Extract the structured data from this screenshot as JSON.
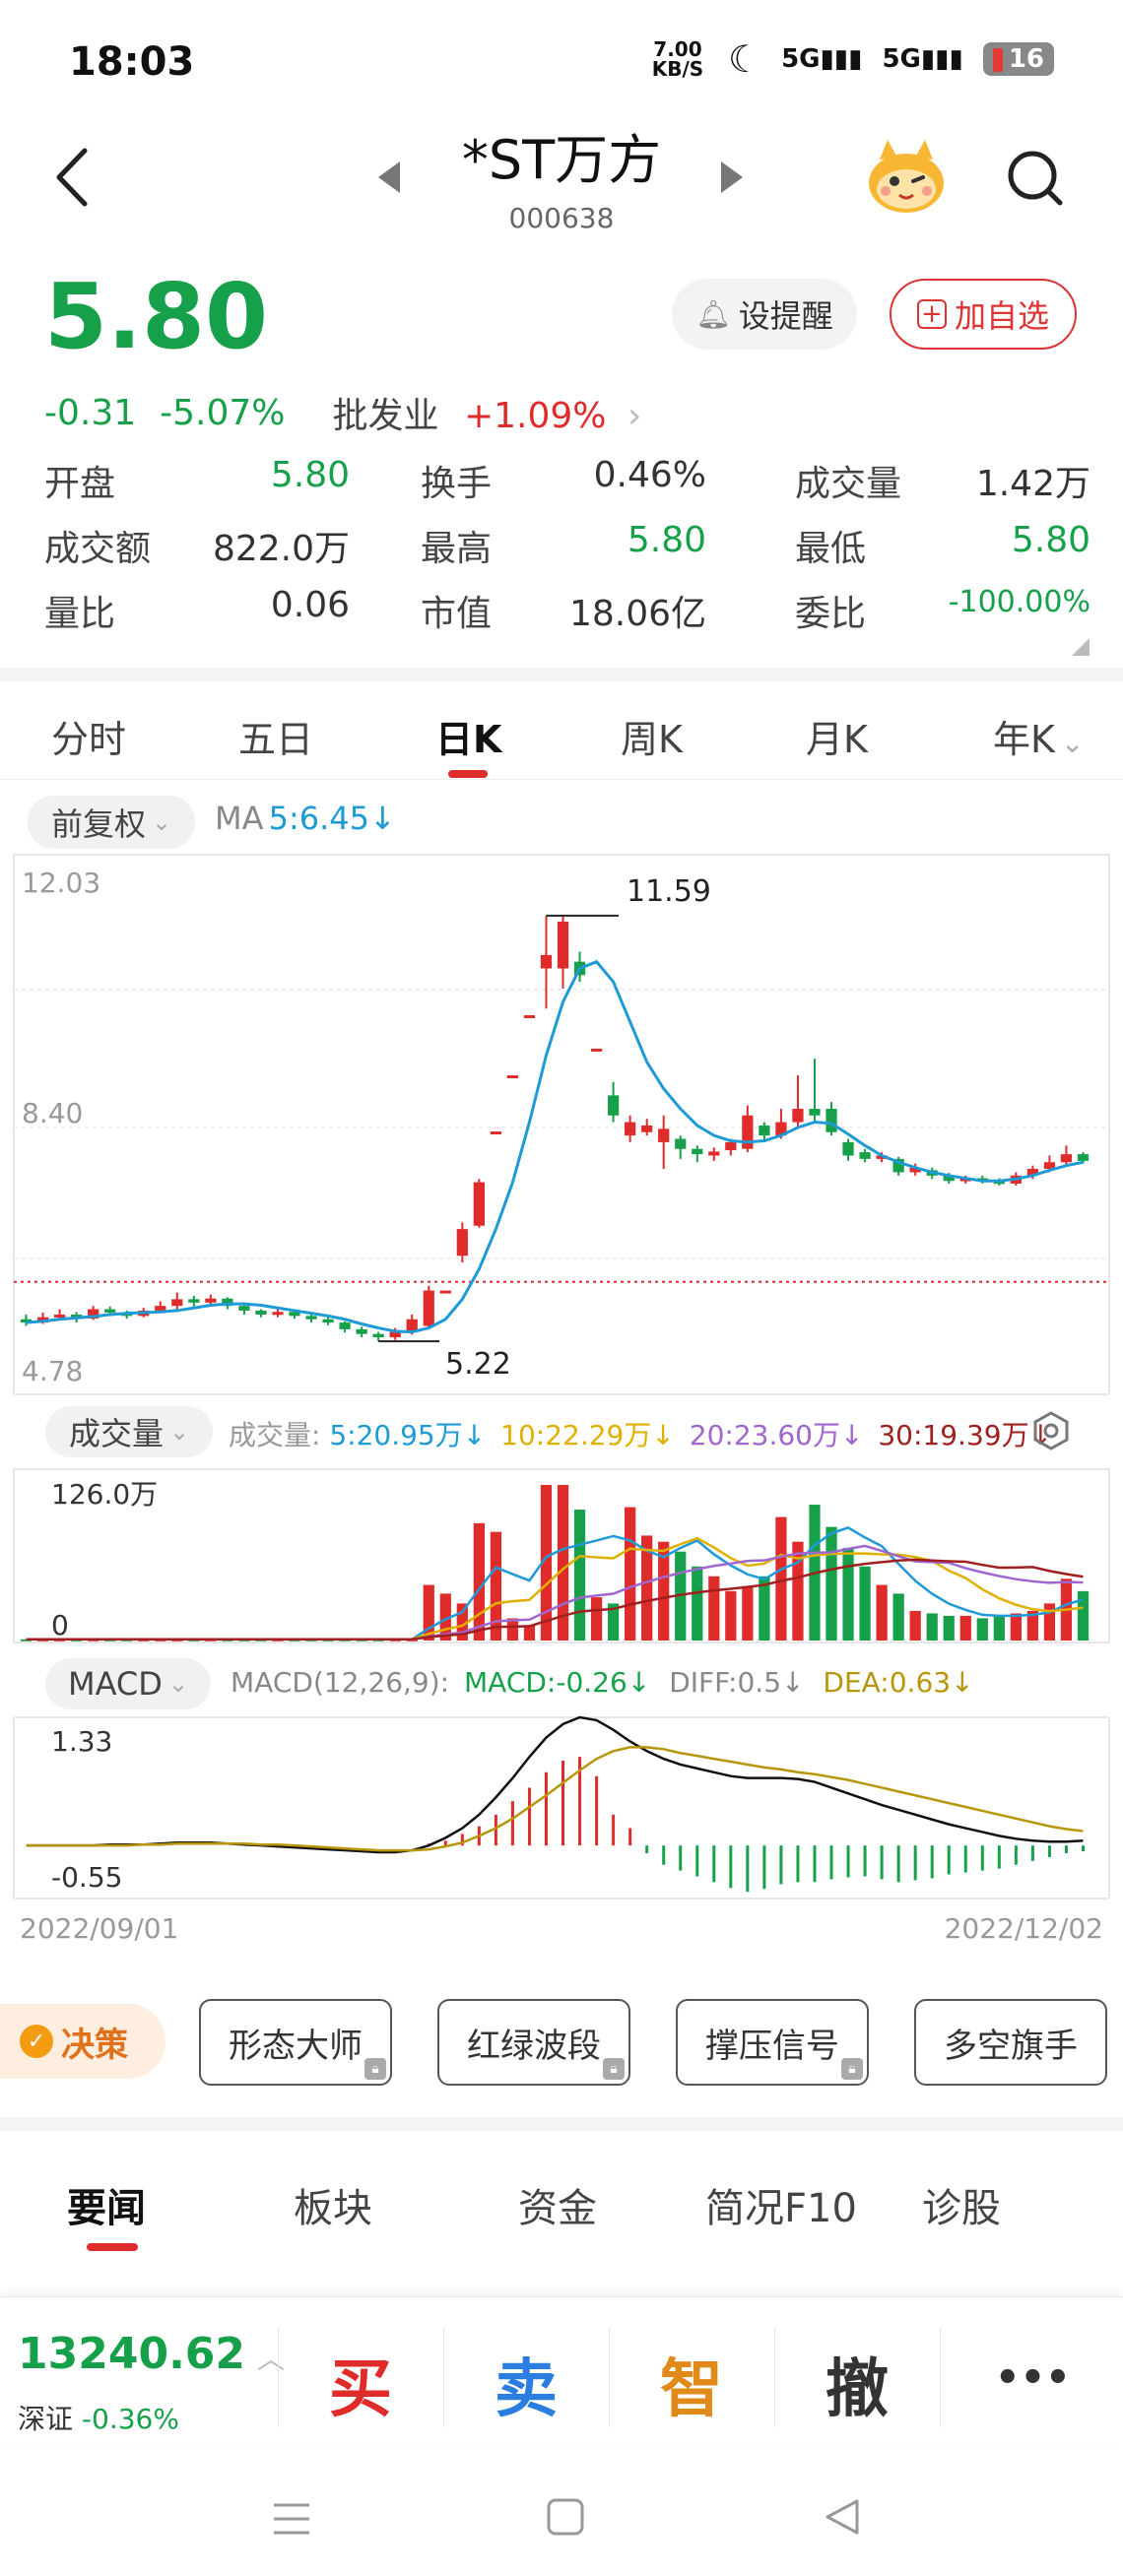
{
  "status_bar": {
    "time": "18:03",
    "net_speed": "7.00 KB/S",
    "signal1": "5G",
    "signal2": "5G",
    "battery": "16"
  },
  "header": {
    "stock_name": "*ST万方",
    "stock_code": "000638",
    "icons": [
      "back-icon",
      "prev-arrow-icon",
      "next-arrow-icon",
      "mascot-icon",
      "search-icon"
    ]
  },
  "quote": {
    "price": "5.80",
    "change": "-0.31",
    "change_pct": "-5.07%",
    "sector": "批发业",
    "sector_change": "+1.09%",
    "alert_label": "设提醒",
    "watch_label": "加自选"
  },
  "stats": [
    {
      "k": "开盘",
      "v": "5.80",
      "color": "#16a04a"
    },
    {
      "k": "换手",
      "v": "0.46%",
      "color": "#333333"
    },
    {
      "k": "成交量",
      "v": "1.42万",
      "color": "#333333"
    },
    {
      "k": "成交额",
      "v": "822.0万",
      "color": "#333333"
    },
    {
      "k": "最高",
      "v": "5.80",
      "color": "#16a04a"
    },
    {
      "k": "最低",
      "v": "5.80",
      "color": "#16a04a"
    },
    {
      "k": "量比",
      "v": "0.06",
      "color": "#333333"
    },
    {
      "k": "市值",
      "v": "18.06亿",
      "color": "#333333"
    },
    {
      "k": "委比",
      "v": "-100.00%",
      "color": "#16a04a"
    }
  ],
  "chart_tabs": [
    "分时",
    "五日",
    "日K",
    "周K",
    "月K",
    "年K"
  ],
  "kline": {
    "adjust": "前复权",
    "ma_label": "MA",
    "ma_value": "5:6.45",
    "y_top": "12.03",
    "y_mid": "8.40",
    "y_bottom": "4.78",
    "high_label": "11.59",
    "low_label": "5.22"
  },
  "volume": {
    "label": "成交量",
    "prefix": "成交量:",
    "ma5": "5:20.95万",
    "ma10": "10:22.29万",
    "ma20": "20:23.60万",
    "ma30": "30:19.39万",
    "y_top": "126.0万",
    "y_zero": "0"
  },
  "macd": {
    "label": "MACD",
    "params": "MACD(12,26,9):",
    "macd": "MACD:-0.26",
    "diff": "DIFF:0.5",
    "dea": "DEA:0.63",
    "y_top": "1.33",
    "y_bottom": "-0.55"
  },
  "date_range": {
    "start": "2022/09/01",
    "end": "2022/12/02"
  },
  "tools": {
    "decision": "决策",
    "buttons": [
      "形态大师",
      "红绿波段",
      "撑压信号",
      "多空旗手"
    ]
  },
  "news_tabs": [
    "要闻",
    "板块",
    "资金",
    "简况F10",
    "诊股"
  ],
  "bottom": {
    "index_value": "13240.62",
    "index_name": "深证",
    "index_change": "-0.36%",
    "buy": "买",
    "sell": "卖",
    "smart": "智",
    "cancel": "撤",
    "more": "•••"
  },
  "colors": {
    "up": "#e02b2b",
    "down": "#16a04a",
    "ma5": "#1e9ad6",
    "ma10": "#e0b000",
    "ma20": "#a066d0",
    "ma30": "#a02020"
  },
  "chart_data": {
    "type": "candlestick",
    "title": "",
    "x_range": [
      "2022/09/01",
      "2022/12/02"
    ],
    "ylim": [
      4.78,
      12.03
    ],
    "candles": [
      {
        "o": 5.55,
        "c": 5.5,
        "h": 5.62,
        "l": 5.45
      },
      {
        "o": 5.5,
        "c": 5.58,
        "h": 5.65,
        "l": 5.48
      },
      {
        "o": 5.58,
        "c": 5.62,
        "h": 5.7,
        "l": 5.55
      },
      {
        "o": 5.62,
        "c": 5.56,
        "h": 5.66,
        "l": 5.5
      },
      {
        "o": 5.56,
        "c": 5.7,
        "h": 5.75,
        "l": 5.54
      },
      {
        "o": 5.7,
        "c": 5.65,
        "h": 5.74,
        "l": 5.6
      },
      {
        "o": 5.65,
        "c": 5.6,
        "h": 5.68,
        "l": 5.56
      },
      {
        "o": 5.6,
        "c": 5.68,
        "h": 5.72,
        "l": 5.58
      },
      {
        "o": 5.68,
        "c": 5.75,
        "h": 5.82,
        "l": 5.64
      },
      {
        "o": 5.75,
        "c": 5.85,
        "h": 5.95,
        "l": 5.7
      },
      {
        "o": 5.85,
        "c": 5.8,
        "h": 5.9,
        "l": 5.72
      },
      {
        "o": 5.8,
        "c": 5.86,
        "h": 5.92,
        "l": 5.76
      },
      {
        "o": 5.86,
        "c": 5.75,
        "h": 5.88,
        "l": 5.7
      },
      {
        "o": 5.75,
        "c": 5.68,
        "h": 5.78,
        "l": 5.62
      },
      {
        "o": 5.68,
        "c": 5.62,
        "h": 5.7,
        "l": 5.58
      },
      {
        "o": 5.62,
        "c": 5.66,
        "h": 5.7,
        "l": 5.58
      },
      {
        "o": 5.66,
        "c": 5.6,
        "h": 5.7,
        "l": 5.56
      },
      {
        "o": 5.6,
        "c": 5.55,
        "h": 5.64,
        "l": 5.5
      },
      {
        "o": 5.55,
        "c": 5.5,
        "h": 5.58,
        "l": 5.46
      },
      {
        "o": 5.5,
        "c": 5.4,
        "h": 5.52,
        "l": 5.35
      },
      {
        "o": 5.4,
        "c": 5.33,
        "h": 5.44,
        "l": 5.28
      },
      {
        "o": 5.33,
        "c": 5.28,
        "h": 5.36,
        "l": 5.22
      },
      {
        "o": 5.28,
        "c": 5.36,
        "h": 5.42,
        "l": 5.24
      },
      {
        "o": 5.36,
        "c": 5.55,
        "h": 5.62,
        "l": 5.32
      },
      {
        "o": 5.45,
        "c": 5.98,
        "h": 6.05,
        "l": 5.4
      },
      {
        "o": 5.98,
        "c": 5.98,
        "h": 5.98,
        "l": 5.98
      },
      {
        "o": 6.5,
        "c": 6.9,
        "h": 7.0,
        "l": 6.4
      },
      {
        "o": 6.95,
        "c": 7.6,
        "h": 7.65,
        "l": 6.92
      },
      {
        "o": 8.36,
        "c": 8.36,
        "h": 8.36,
        "l": 8.36
      },
      {
        "o": 9.2,
        "c": 9.2,
        "h": 9.2,
        "l": 9.2
      },
      {
        "o": 10.1,
        "c": 10.1,
        "h": 10.1,
        "l": 10.1
      },
      {
        "o": 10.8,
        "c": 11.0,
        "h": 11.59,
        "l": 10.2
      },
      {
        "o": 10.8,
        "c": 11.5,
        "h": 11.59,
        "l": 10.5
      },
      {
        "o": 10.9,
        "c": 10.7,
        "h": 11.05,
        "l": 10.6
      },
      {
        "o": 9.6,
        "c": 9.6,
        "h": 9.6,
        "l": 9.6
      },
      {
        "o": 8.9,
        "c": 8.6,
        "h": 9.1,
        "l": 8.5
      },
      {
        "o": 8.3,
        "c": 8.5,
        "h": 8.6,
        "l": 8.2
      },
      {
        "o": 8.35,
        "c": 8.45,
        "h": 8.55,
        "l": 8.3
      },
      {
        "o": 8.2,
        "c": 8.4,
        "h": 8.6,
        "l": 7.8
      },
      {
        "o": 8.25,
        "c": 8.1,
        "h": 8.3,
        "l": 7.95
      },
      {
        "o": 8.1,
        "c": 8.02,
        "h": 8.15,
        "l": 7.9
      },
      {
        "o": 8.0,
        "c": 8.06,
        "h": 8.12,
        "l": 7.92
      },
      {
        "o": 8.08,
        "c": 8.2,
        "h": 8.25,
        "l": 8.0
      },
      {
        "o": 8.1,
        "c": 8.6,
        "h": 8.75,
        "l": 8.05
      },
      {
        "o": 8.45,
        "c": 8.3,
        "h": 8.5,
        "l": 8.2
      },
      {
        "o": 8.3,
        "c": 8.5,
        "h": 8.7,
        "l": 8.25
      },
      {
        "o": 8.5,
        "c": 8.7,
        "h": 9.2,
        "l": 8.4
      },
      {
        "o": 8.7,
        "c": 8.6,
        "h": 9.45,
        "l": 8.5
      },
      {
        "o": 8.7,
        "c": 8.35,
        "h": 8.8,
        "l": 8.3
      },
      {
        "o": 8.2,
        "c": 8.0,
        "h": 8.25,
        "l": 7.92
      },
      {
        "o": 8.05,
        "c": 7.95,
        "h": 8.1,
        "l": 7.9
      },
      {
        "o": 7.95,
        "c": 8.0,
        "h": 8.05,
        "l": 7.9
      },
      {
        "o": 7.95,
        "c": 7.75,
        "h": 7.98,
        "l": 7.7
      },
      {
        "o": 7.75,
        "c": 7.82,
        "h": 7.88,
        "l": 7.7
      },
      {
        "o": 7.78,
        "c": 7.7,
        "h": 7.82,
        "l": 7.65
      },
      {
        "o": 7.7,
        "c": 7.62,
        "h": 7.74,
        "l": 7.58
      },
      {
        "o": 7.62,
        "c": 7.66,
        "h": 7.7,
        "l": 7.58
      },
      {
        "o": 7.66,
        "c": 7.62,
        "h": 7.7,
        "l": 7.58
      },
      {
        "o": 7.62,
        "c": 7.58,
        "h": 7.66,
        "l": 7.55
      },
      {
        "o": 7.58,
        "c": 7.7,
        "h": 7.75,
        "l": 7.55
      },
      {
        "o": 7.7,
        "c": 7.8,
        "h": 7.85,
        "l": 7.65
      },
      {
        "o": 7.8,
        "c": 7.9,
        "h": 8.0,
        "l": 7.75
      },
      {
        "o": 7.9,
        "c": 8.02,
        "h": 8.15,
        "l": 7.85
      },
      {
        "o": 8.02,
        "c": 7.92,
        "h": 8.05,
        "l": 7.88
      }
    ],
    "ma5": [
      5.5,
      5.52,
      5.55,
      5.57,
      5.59,
      5.62,
      5.64,
      5.65,
      5.66,
      5.68,
      5.72,
      5.76,
      5.78,
      5.78,
      5.76,
      5.72,
      5.68,
      5.64,
      5.6,
      5.55,
      5.48,
      5.42,
      5.37,
      5.36,
      5.42,
      5.55,
      5.85,
      6.3,
      6.9,
      7.6,
      8.5,
      9.5,
      10.3,
      10.8,
      10.9,
      10.6,
      10.0,
      9.4,
      9.0,
      8.7,
      8.45,
      8.3,
      8.22,
      8.2,
      8.22,
      8.3,
      8.42,
      8.5,
      8.48,
      8.32,
      8.15,
      8.0,
      7.9,
      7.82,
      7.75,
      7.7,
      7.66,
      7.62,
      7.62,
      7.65,
      7.7,
      7.78,
      7.85,
      7.9
    ],
    "volume_ylim": [
      0,
      126.0
    ],
    "volume_unit": "万",
    "volume": [
      1,
      1,
      1,
      1,
      1,
      1,
      1,
      1,
      1,
      1,
      1,
      1,
      1,
      1,
      1,
      1,
      1,
      1,
      1,
      1,
      1,
      1,
      1,
      1,
      45,
      38,
      30,
      95,
      88,
      18,
      12,
      126,
      126,
      106,
      35,
      30,
      108,
      85,
      80,
      72,
      60,
      52,
      40,
      44,
      52,
      100,
      80,
      110,
      92,
      75,
      60,
      45,
      38,
      24,
      22,
      20,
      20,
      18,
      20,
      22,
      24,
      30,
      50,
      40
    ],
    "macd_ylim": [
      -0.55,
      1.33
    ],
    "macd_hist": [
      0.0,
      0.0,
      0.0,
      0.0,
      0.0,
      0.0,
      0.0,
      0.0,
      0.0,
      0.0,
      0.0,
      0.0,
      0.0,
      0.0,
      0.0,
      0.0,
      0.0,
      0.0,
      0.0,
      0.0,
      0.0,
      0.0,
      0.0,
      0.0,
      0.02,
      0.05,
      0.12,
      0.2,
      0.32,
      0.46,
      0.6,
      0.76,
      0.88,
      0.92,
      0.72,
      0.32,
      0.18,
      -0.08,
      -0.2,
      -0.26,
      -0.32,
      -0.38,
      -0.44,
      -0.48,
      -0.45,
      -0.4,
      -0.38,
      -0.38,
      -0.35,
      -0.33,
      -0.32,
      -0.35,
      -0.38,
      -0.36,
      -0.34,
      -0.3,
      -0.28,
      -0.26,
      -0.24,
      -0.2,
      -0.16,
      -0.12,
      -0.08,
      -0.06
    ],
    "macd_diff": [
      0.0,
      0.0,
      0.0,
      0.0,
      0.0,
      0.01,
      0.01,
      0.01,
      0.02,
      0.03,
      0.03,
      0.03,
      0.02,
      0.01,
      0.0,
      -0.01,
      -0.02,
      -0.03,
      -0.04,
      -0.05,
      -0.06,
      -0.07,
      -0.07,
      -0.05,
      0.0,
      0.08,
      0.18,
      0.32,
      0.5,
      0.7,
      0.92,
      1.12,
      1.26,
      1.33,
      1.3,
      1.2,
      1.08,
      0.98,
      0.9,
      0.84,
      0.8,
      0.76,
      0.72,
      0.7,
      0.7,
      0.7,
      0.69,
      0.66,
      0.6,
      0.54,
      0.48,
      0.42,
      0.37,
      0.32,
      0.27,
      0.22,
      0.18,
      0.14,
      0.1,
      0.07,
      0.05,
      0.04,
      0.04,
      0.05
    ],
    "macd_dea": [
      0.0,
      0.0,
      0.0,
      0.0,
      0.0,
      0.0,
      0.0,
      0.01,
      0.01,
      0.02,
      0.02,
      0.02,
      0.02,
      0.02,
      0.01,
      0.01,
      0.0,
      -0.01,
      -0.02,
      -0.03,
      -0.04,
      -0.05,
      -0.05,
      -0.05,
      -0.04,
      -0.01,
      0.03,
      0.1,
      0.18,
      0.28,
      0.4,
      0.52,
      0.65,
      0.78,
      0.9,
      0.98,
      1.02,
      1.02,
      1.0,
      0.96,
      0.93,
      0.9,
      0.87,
      0.84,
      0.81,
      0.79,
      0.76,
      0.74,
      0.71,
      0.68,
      0.64,
      0.6,
      0.56,
      0.52,
      0.48,
      0.44,
      0.4,
      0.36,
      0.32,
      0.28,
      0.24,
      0.2,
      0.17,
      0.15
    ]
  }
}
